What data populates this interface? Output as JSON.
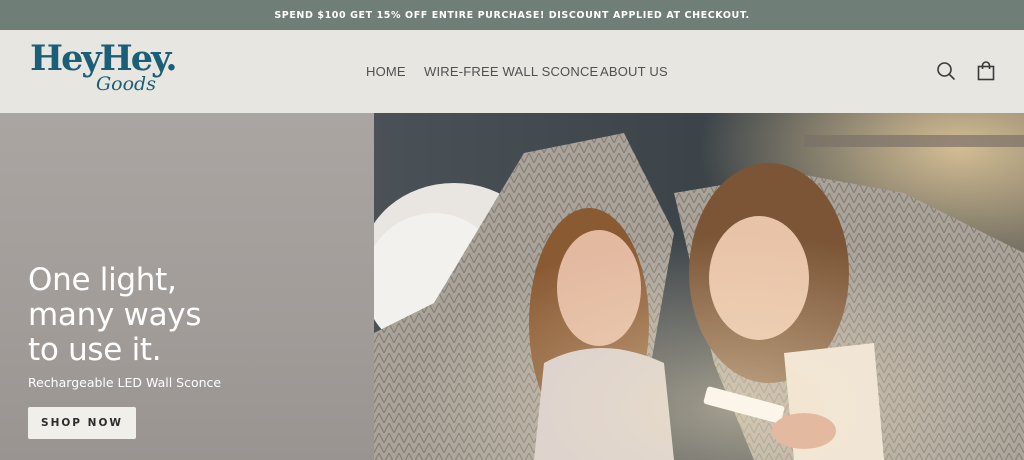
{
  "announcement": {
    "text": "SPEND $100 GET 15% OFF ENTIRE PURCHASE! DISCOUNT APPLIED AT CHECKOUT."
  },
  "brand": {
    "name_top": "HeyHey.",
    "name_bottom": "Goods",
    "color": "#1a5e78"
  },
  "nav": {
    "items": [
      {
        "label": "HOME"
      },
      {
        "label": "WIRE-FREE WALL SCONCE"
      },
      {
        "label": "ABOUT US"
      }
    ]
  },
  "header_icons": {
    "search": "search-icon",
    "cart": "cart-icon"
  },
  "hero": {
    "headline_lines": [
      "One light,",
      "many ways",
      "to use it."
    ],
    "subheading": "Rechargeable LED Wall Sconce",
    "cta_label": "SHOP NOW"
  },
  "colors": {
    "announcement_bg": "#6f7e76",
    "header_bg": "#e8e6e0",
    "hero_panel_bg": "#a29c99",
    "cta_bg": "#f1efea"
  }
}
